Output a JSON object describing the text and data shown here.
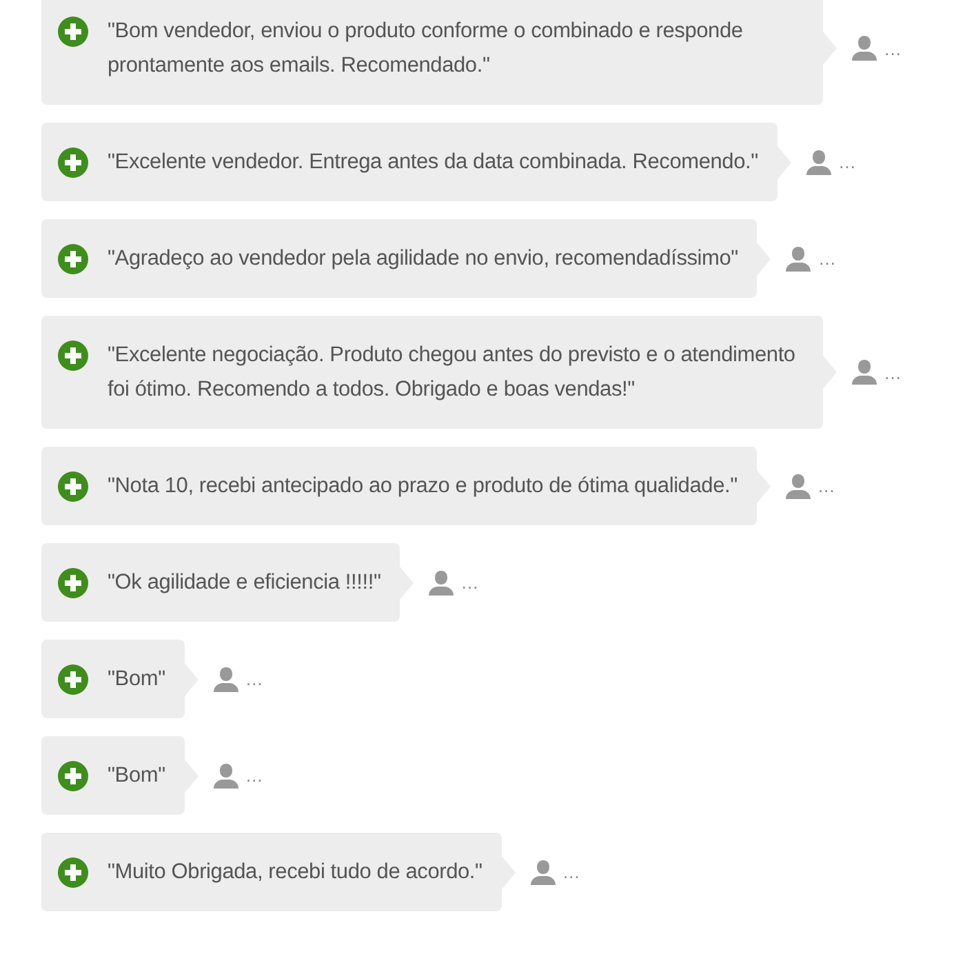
{
  "feedback": [
    {
      "kind": "positive",
      "comment": "\"Bom vendedor, enviou o produto conforme o combinado e responde prontamente aos emails. Recomendado.\"",
      "author": "…"
    },
    {
      "kind": "positive",
      "comment": "\"Excelente vendedor. Entrega antes da data combinada. Recomendo.\"",
      "author": "…"
    },
    {
      "kind": "positive",
      "comment": "\"Agradeço ao vendedor pela agilidade no envio, recomendadíssimo\"",
      "author": "…"
    },
    {
      "kind": "positive",
      "comment": "\"Excelente negociação. Produto chegou antes do previsto e o atendimento foi ótimo. Recomendo a todos. Obrigado e boas vendas!\"",
      "author": "…"
    },
    {
      "kind": "positive",
      "comment": "\"Nota 10, recebi antecipado ao prazo e produto de ótima qualidade.\"",
      "author": "…"
    },
    {
      "kind": "positive",
      "comment": "\"Ok agilidade e eficiencia !!!!!\"",
      "author": "…"
    },
    {
      "kind": "positive",
      "comment": "\"Bom\"",
      "author": "…"
    },
    {
      "kind": "positive",
      "comment": "\"Bom\"",
      "author": "…"
    },
    {
      "kind": "positive",
      "comment": "\"Muito Obrigada, recebi tudo de acordo.\"",
      "author": "…"
    }
  ]
}
